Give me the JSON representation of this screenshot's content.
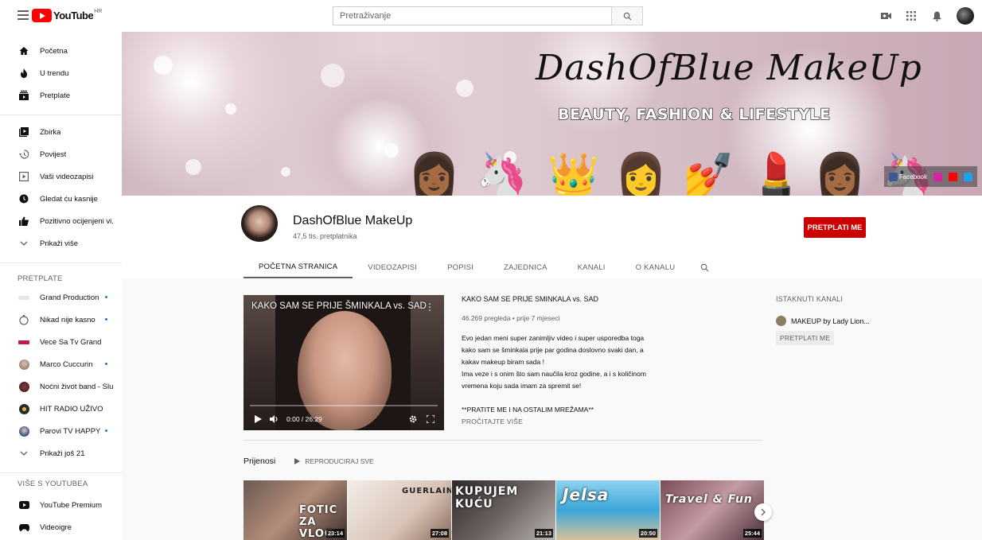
{
  "header": {
    "logo_text": "YouTube",
    "country_code": "HR",
    "search_placeholder": "Pretraživanje",
    "icons": [
      "video-camera-icon",
      "apps-grid-icon",
      "bell-icon",
      "account-avatar"
    ]
  },
  "sidebar": {
    "main": [
      {
        "label": "Početna",
        "icon": "home-icon"
      },
      {
        "label": "U trendu",
        "icon": "flame-icon"
      },
      {
        "label": "Pretplate",
        "icon": "subscriptions-icon"
      }
    ],
    "library": [
      {
        "label": "Zbirka",
        "icon": "library-icon"
      },
      {
        "label": "Povijest",
        "icon": "history-icon"
      },
      {
        "label": "Vaši videozapisi",
        "icon": "your-videos-icon"
      },
      {
        "label": "Gledat ću kasnije",
        "icon": "watch-later-icon"
      },
      {
        "label": "Pozitivno ocijenjeni vi...",
        "icon": "thumbs-up-icon"
      },
      {
        "label": "Prikaži više",
        "icon": "chevron-down-icon"
      }
    ],
    "subscriptions_heading": "PRETPLATE",
    "subscriptions": [
      {
        "label": "Grand Production",
        "new": true,
        "color": "#d9d9d9"
      },
      {
        "label": "Nikad nije kasno",
        "new": true,
        "color": "#ffffff"
      },
      {
        "label": "Vece Sa Tv Grand",
        "new": false,
        "color": "#c2185b"
      },
      {
        "label": "Marco Cuccurin",
        "new": true,
        "color": "#8c7a6b"
      },
      {
        "label": "Noćni život band - Slu...",
        "new": false,
        "color": "#5b2c2c"
      },
      {
        "label": "HIT RADIO UŽIVO",
        "new": false,
        "color": "#3a3a3a"
      },
      {
        "label": "Parovi TV HAPPY",
        "new": true,
        "color": "#2f4f7f"
      },
      {
        "label": "Prikaži još 21",
        "new": false,
        "color": ""
      }
    ],
    "more_heading": "VIŠE S YOUTUBEA",
    "more": [
      {
        "label": "YouTube Premium",
        "icon": "youtube-premium-icon"
      },
      {
        "label": "Videoigre",
        "icon": "gaming-icon"
      }
    ]
  },
  "banner": {
    "title": "DashOfBlue MakeUp",
    "subtitle": "BEAUTY, FASHION & LIFESTYLE",
    "social": [
      "Facebook",
      "Instagram",
      "YouTube",
      "Twitter"
    ]
  },
  "channel": {
    "name": "DashOfBlue MakeUp",
    "subscribers": "47,5 tis. pretplatnika",
    "subscribe_label": "PRETPLATI ME",
    "tabs": [
      "POČETNA STRANICA",
      "VIDEOZAPISI",
      "POPISI",
      "ZAJEDNICA",
      "KANALI",
      "O KANALU"
    ],
    "active_tab": 0
  },
  "featured": {
    "player_title": "KAKO SAM SE PRIJE ŠMINKALA vs. SAD",
    "time": "0:00 / 26:29",
    "title": "KAKO SAM SE PRIJE SMINKALA vs. SAD",
    "meta": "46.269 pregleda • prije 7 mjeseci",
    "description": "Evo jedan meni super zanimljiv video i super usporedba toga kako sam se šminkala prije par godina doslovno svaki dan, a kakav makeup biram sada !\nIma veze i s onim što sam naučila kroz godine, a i s količinom vremena koju sada imam za spremit se!\n\n**PRATITE ME I NA OSTALIM MREŽAMA**",
    "read_more": "PROČITAJTE VIŠE"
  },
  "featured_channels": {
    "heading": "ISTAKNUTI KANALI",
    "channel_name": "MAKEUP by Lady Lion...",
    "subscribe_label": "PRETPLATI ME"
  },
  "uploads": {
    "title": "Prijenosi",
    "play_all": "REPRODUCIRAJ SVE",
    "thumbs": [
      {
        "overlay": "FOTIC ZA VLOG",
        "duration": "23:14"
      },
      {
        "overlay": "GUERLAIN",
        "duration": "27:08"
      },
      {
        "overlay": "KUPUJEM KUĆU",
        "duration": "21:13"
      },
      {
        "overlay": "Jelsa",
        "duration": "20:50"
      },
      {
        "overlay": "Travel & Fun",
        "duration": "25:44"
      }
    ]
  },
  "colors": {
    "brand_red": "#ff0000",
    "subscribe_red": "#cc0000",
    "accent_blue": "#1a73e8"
  }
}
